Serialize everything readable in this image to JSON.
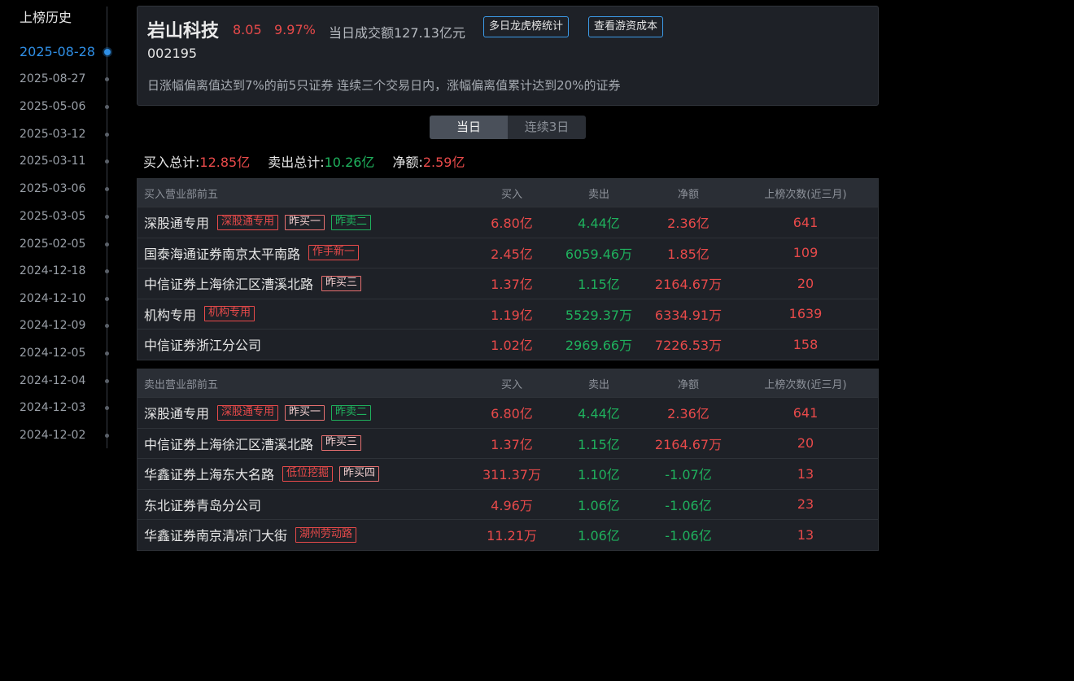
{
  "sidebar": {
    "title": "上榜历史",
    "dates": [
      {
        "label": "2025-08-28",
        "active": true
      },
      {
        "label": "2025-08-27",
        "active": false
      },
      {
        "label": "2025-05-06",
        "active": false
      },
      {
        "label": "2025-03-12",
        "active": false
      },
      {
        "label": "2025-03-11",
        "active": false
      },
      {
        "label": "2025-03-06",
        "active": false
      },
      {
        "label": "2025-03-05",
        "active": false
      },
      {
        "label": "2025-02-05",
        "active": false
      },
      {
        "label": "2024-12-18",
        "active": false
      },
      {
        "label": "2024-12-10",
        "active": false
      },
      {
        "label": "2024-12-09",
        "active": false
      },
      {
        "label": "2024-12-05",
        "active": false
      },
      {
        "label": "2024-12-04",
        "active": false
      },
      {
        "label": "2024-12-03",
        "active": false
      },
      {
        "label": "2024-12-02",
        "active": false
      }
    ]
  },
  "header": {
    "name": "岩山科技",
    "price": "8.05",
    "change_pct": "9.97%",
    "turnover": "当日成交额127.13亿元",
    "btn_multi_day": "多日龙虎榜统计",
    "btn_cost": "查看游资成本",
    "code": "002195",
    "reason": "日涨幅偏离值达到7%的前5只证券 连续三个交易日内，涨幅偏离值累计达到20%的证券"
  },
  "tabs": {
    "today": "当日",
    "three_days": "连续3日",
    "active": "today"
  },
  "totals": {
    "buy_label": "买入总计:",
    "buy_value": "12.85亿",
    "sell_label": "卖出总计:",
    "sell_value": "10.26亿",
    "net_label": "净额:",
    "net_value": "2.59亿"
  },
  "colors": {
    "up": "#e84a4a",
    "down": "#1fb15d",
    "accent": "#2f8fe6"
  },
  "buy_table": {
    "headers": {
      "name": "买入营业部前五",
      "buy": "买入",
      "sell": "卖出",
      "net": "净额",
      "count": "上榜次数(近三月)"
    },
    "rows": [
      {
        "name": "深股通专用",
        "tags": [
          {
            "text": "深股通专用",
            "style": "red"
          },
          {
            "text": "昨买一",
            "style": "pink"
          },
          {
            "text": "昨卖二",
            "style": "green"
          }
        ],
        "buy": "6.80亿",
        "sell": "4.44亿",
        "net": "2.36亿",
        "net_dir": "up",
        "count": "641"
      },
      {
        "name": "国泰海通证券南京太平南路",
        "tags": [
          {
            "text": "作手新一",
            "style": "red"
          }
        ],
        "buy": "2.45亿",
        "sell": "6059.46万",
        "net": "1.85亿",
        "net_dir": "up",
        "count": "109"
      },
      {
        "name": "中信证券上海徐汇区漕溪北路",
        "tags": [
          {
            "text": "昨买三",
            "style": "pink"
          }
        ],
        "buy": "1.37亿",
        "sell": "1.15亿",
        "net": "2164.67万",
        "net_dir": "up",
        "count": "20"
      },
      {
        "name": "机构专用",
        "tags": [
          {
            "text": "机构专用",
            "style": "red"
          }
        ],
        "buy": "1.19亿",
        "sell": "5529.37万",
        "net": "6334.91万",
        "net_dir": "up",
        "count": "1639"
      },
      {
        "name": "中信证券浙江分公司",
        "tags": [],
        "buy": "1.02亿",
        "sell": "2969.66万",
        "net": "7226.53万",
        "net_dir": "up",
        "count": "158"
      }
    ]
  },
  "sell_table": {
    "headers": {
      "name": "卖出营业部前五",
      "buy": "买入",
      "sell": "卖出",
      "net": "净额",
      "count": "上榜次数(近三月)"
    },
    "rows": [
      {
        "name": "深股通专用",
        "tags": [
          {
            "text": "深股通专用",
            "style": "red"
          },
          {
            "text": "昨买一",
            "style": "pink"
          },
          {
            "text": "昨卖二",
            "style": "green"
          }
        ],
        "buy": "6.80亿",
        "sell": "4.44亿",
        "net": "2.36亿",
        "net_dir": "up",
        "count": "641"
      },
      {
        "name": "中信证券上海徐汇区漕溪北路",
        "tags": [
          {
            "text": "昨买三",
            "style": "pink"
          }
        ],
        "buy": "1.37亿",
        "sell": "1.15亿",
        "net": "2164.67万",
        "net_dir": "up",
        "count": "20"
      },
      {
        "name": "华鑫证券上海东大名路",
        "tags": [
          {
            "text": "低位挖掘",
            "style": "red"
          },
          {
            "text": "昨买四",
            "style": "pink"
          }
        ],
        "buy": "311.37万",
        "sell": "1.10亿",
        "net": "-1.07亿",
        "net_dir": "down",
        "count": "13"
      },
      {
        "name": "东北证券青岛分公司",
        "tags": [],
        "buy": "4.96万",
        "sell": "1.06亿",
        "net": "-1.06亿",
        "net_dir": "down",
        "count": "23"
      },
      {
        "name": "华鑫证券南京清凉门大街",
        "tags": [
          {
            "text": "湖州劳动路",
            "style": "red"
          }
        ],
        "buy": "11.21万",
        "sell": "1.06亿",
        "net": "-1.06亿",
        "net_dir": "down",
        "count": "13"
      }
    ]
  }
}
